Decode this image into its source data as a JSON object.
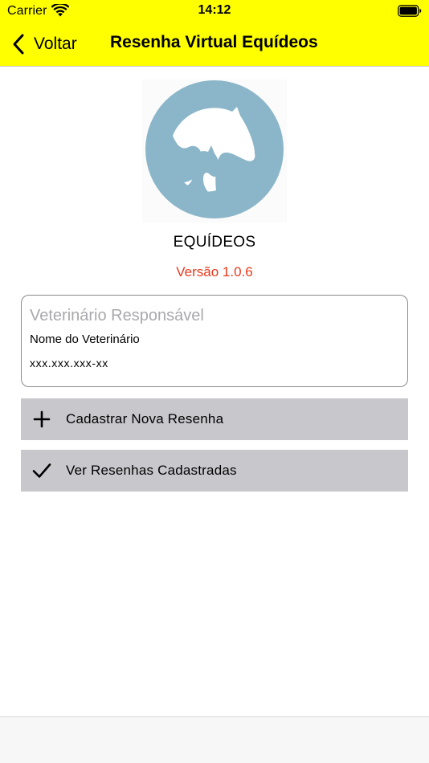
{
  "status_bar": {
    "carrier": "Carrier",
    "time": "14:12",
    "wifi_icon": "wifi-icon",
    "battery_icon": "battery-icon"
  },
  "nav": {
    "back_label": "Voltar",
    "back_icon": "chevron-left-icon",
    "title": "Resenha Virtual Equídeos",
    "background_color": "#ffff00"
  },
  "logo": {
    "icon": "horse-heads-logo",
    "color": "#8bb6c9"
  },
  "app": {
    "name": "EQUÍDEOS",
    "version": "Versão 1.0.6",
    "version_color": "#e8391b"
  },
  "vet_card": {
    "placeholder": "Veterinário Responsável",
    "name": "Nome do Veterinário",
    "cpf": "xxx.xxx.xxx-xx"
  },
  "actions": [
    {
      "label": "Cadastrar Nova Resenha",
      "icon": "plus-icon"
    },
    {
      "label": "Ver Resenhas Cadastradas",
      "icon": "checkmark-icon"
    }
  ],
  "colors": {
    "button_background": "#c8c7cc"
  }
}
